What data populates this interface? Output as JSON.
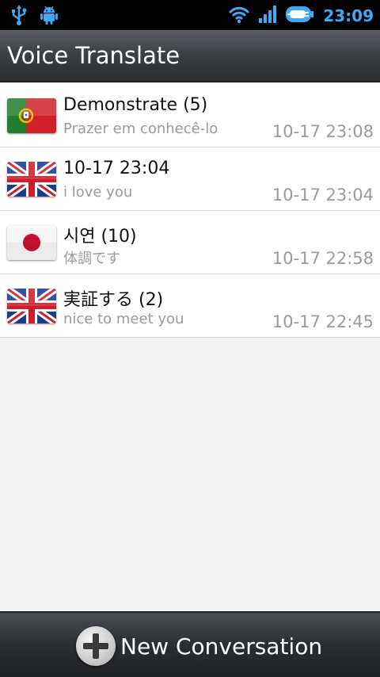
{
  "status_bar": {
    "time": "23:09",
    "icons": [
      "usb-icon",
      "android-debug-icon",
      "wifi-icon",
      "signal-icon",
      "battery-charging-icon"
    ]
  },
  "app": {
    "title": "Voice Translate"
  },
  "conversations": [
    {
      "flag": "portugal-flag-icon",
      "title": "Demonstrate (5)",
      "subtitle": "Prazer em conhecê-lo",
      "time": "10-17 23:08"
    },
    {
      "flag": "uk-flag-icon",
      "title": "10-17 23:04",
      "subtitle": "i love you",
      "time": "10-17 23:04"
    },
    {
      "flag": "japan-flag-icon",
      "title": "시연 (10)",
      "subtitle": "体調です",
      "time": "10-17 22:58"
    },
    {
      "flag": "uk-flag-icon",
      "title": "実証する (2)",
      "subtitle": "nice to meet you",
      "time": "10-17 22:45"
    }
  ],
  "footer": {
    "new_button_label": "New Conversation",
    "new_button_icon": "plus-icon"
  },
  "colors": {
    "status_time": "#3fa9f5",
    "title_bar": "#3d4145",
    "subtext": "#9a9a9a"
  }
}
